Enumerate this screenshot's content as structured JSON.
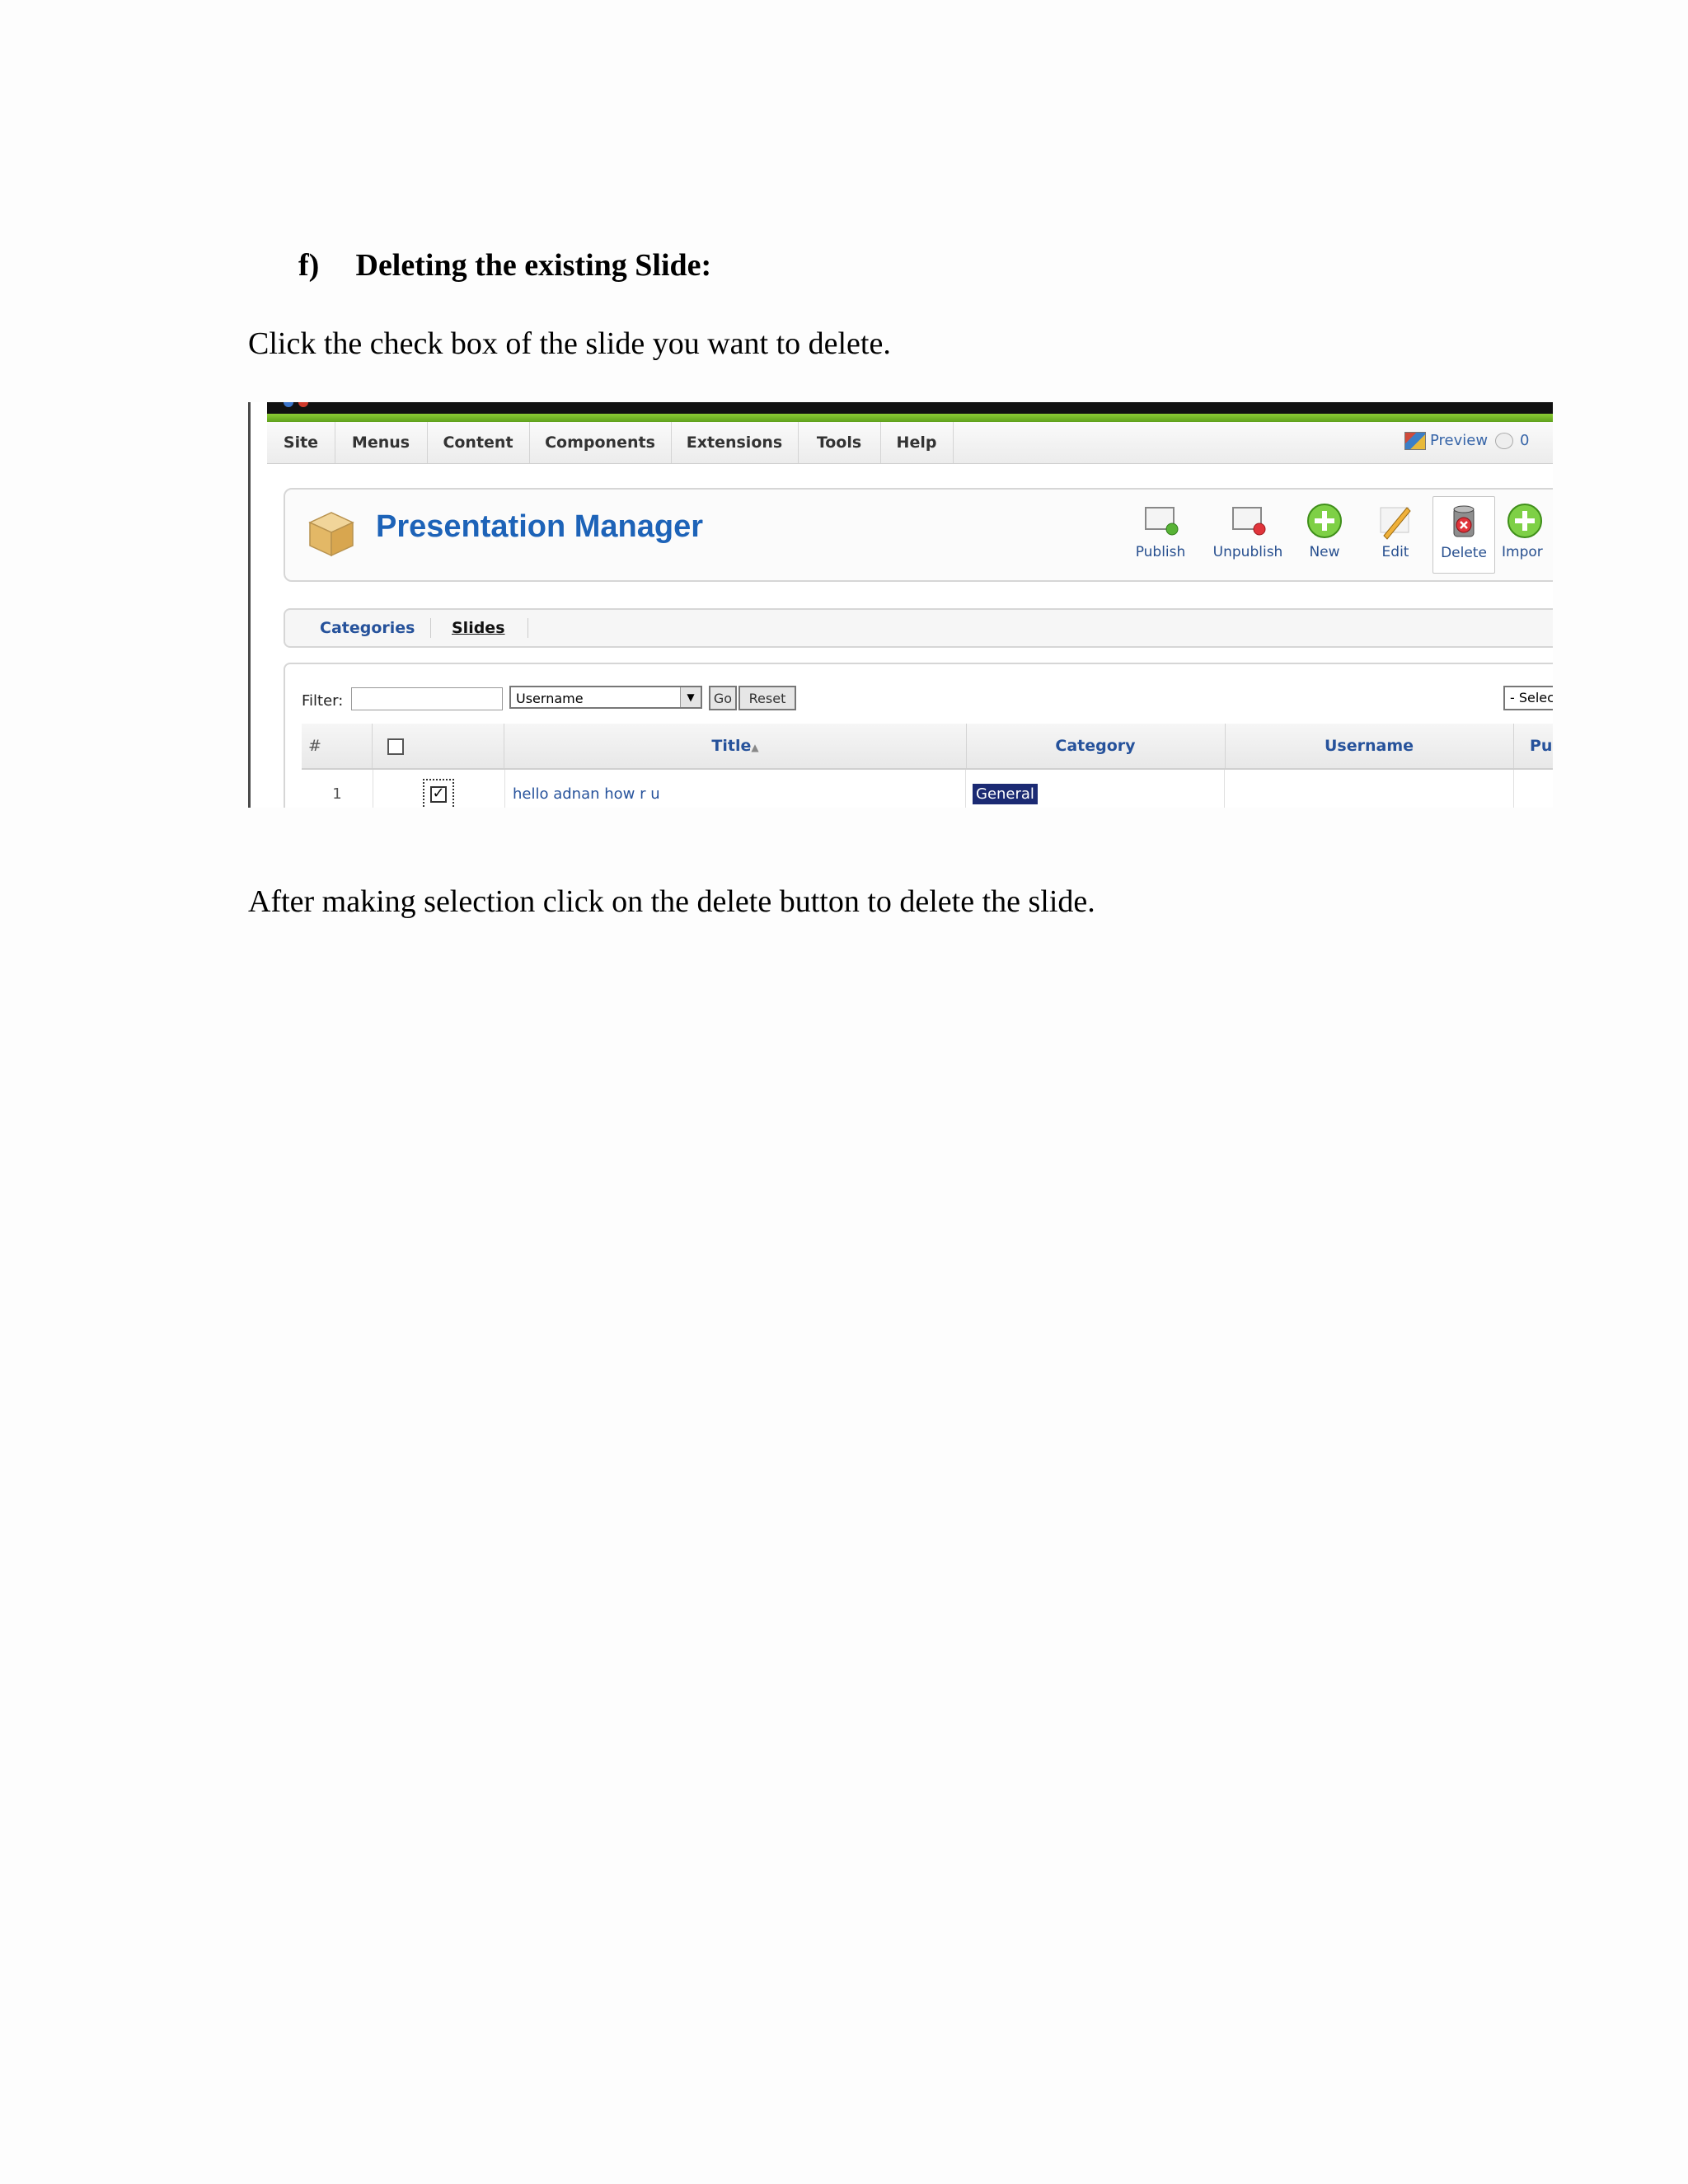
{
  "document": {
    "heading_marker": "f)",
    "heading_text": "Deleting the existing Slide:",
    "intro": "Click the check box of the slide you want to delete.",
    "outro": "After making selection click on the delete button to delete the slide."
  },
  "screenshot": {
    "menu": [
      "Site",
      "Menus",
      "Content",
      "Components",
      "Extensions",
      "Tools",
      "Help"
    ],
    "preview_label": "Preview",
    "message_count": "0",
    "title": "Presentation Manager",
    "toolbar": {
      "publish": "Publish",
      "unpublish": "Unpublish",
      "new": "New",
      "edit": "Edit",
      "delete": "Delete",
      "import": "Impor"
    },
    "subnav": {
      "categories": "Categories",
      "slides": "Slides"
    },
    "filter": {
      "label": "Filter:",
      "value": "",
      "select_value": "Username",
      "go": "Go",
      "reset": "Reset",
      "right_select": "- Select a"
    },
    "table": {
      "columns": [
        "#",
        "",
        "Title",
        "Category",
        "Username",
        "Pu"
      ],
      "sort_indicator": "▲",
      "rows": [
        {
          "num": "1",
          "checked": true,
          "title": "hello adnan how r u",
          "category": "General",
          "username": ""
        }
      ]
    },
    "colors": {
      "accent_green": "#6db526",
      "title_blue": "#1d63b8",
      "header_blue": "#26529b",
      "selection": "#1b2a73"
    }
  }
}
